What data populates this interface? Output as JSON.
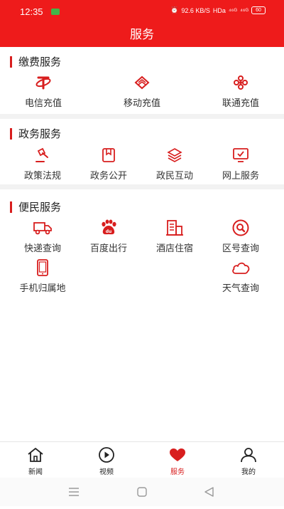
{
  "status": {
    "time": "12:35",
    "network_speed": "92.6 KB/S",
    "hd": "HDa",
    "signal1": "⁴⁶ᴳ",
    "signal2": "⁴⁶ᴳ",
    "battery": "60"
  },
  "header": {
    "title": "服务"
  },
  "sections": [
    {
      "title": "缴费服务",
      "items": [
        {
          "label": "电信充值",
          "icon": "telecom-logo-icon"
        },
        {
          "label": "移动充值",
          "icon": "mobile-logo-icon"
        },
        {
          "label": "联通充值",
          "icon": "unicom-logo-icon"
        }
      ]
    },
    {
      "title": "政务服务",
      "items": [
        {
          "label": "政策法规",
          "icon": "gavel-icon"
        },
        {
          "label": "政务公开",
          "icon": "bookmark-icon"
        },
        {
          "label": "政民互动",
          "icon": "layers-icon"
        },
        {
          "label": "网上服务",
          "icon": "monitor-check-icon"
        }
      ]
    },
    {
      "title": "便民服务",
      "items": [
        {
          "label": "快递查询",
          "icon": "truck-icon"
        },
        {
          "label": "百度出行",
          "icon": "baidu-paw-icon"
        },
        {
          "label": "酒店住宿",
          "icon": "building-icon"
        },
        {
          "label": "区号查询",
          "icon": "search-circle-icon"
        },
        {
          "label": "手机归属地",
          "icon": "phone-icon"
        },
        {
          "label": "天气查询",
          "icon": "cloud-icon"
        }
      ]
    }
  ],
  "tabs": [
    {
      "label": "新闻",
      "icon": "home-icon",
      "active": false
    },
    {
      "label": "视频",
      "icon": "play-icon",
      "active": false
    },
    {
      "label": "服务",
      "icon": "heart-icon",
      "active": true
    },
    {
      "label": "我的",
      "icon": "user-icon",
      "active": false
    }
  ],
  "colors": {
    "brand_red": "#ee1b1b",
    "icon_red": "#d81e1e",
    "divider": "#f2f2f2"
  }
}
